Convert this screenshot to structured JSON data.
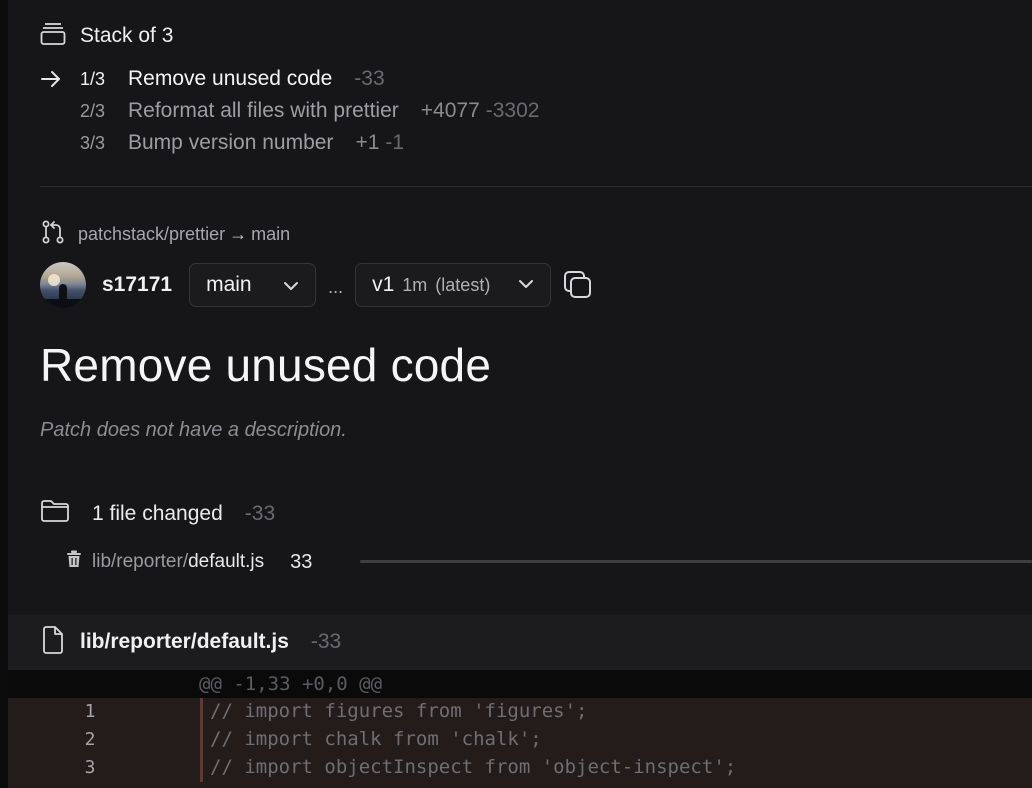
{
  "stack": {
    "title": "Stack of 3",
    "items": [
      {
        "index": "1/3",
        "title": "Remove unused code",
        "additions": "",
        "deletions": "-33",
        "active": true
      },
      {
        "index": "2/3",
        "title": "Reformat all files with prettier",
        "additions": "+4077",
        "deletions": "-3302",
        "active": false
      },
      {
        "index": "3/3",
        "title": "Bump version number",
        "additions": "+1",
        "deletions": "-1",
        "active": false
      }
    ]
  },
  "branch": {
    "source": "patchstack/prettier",
    "arrow": "→",
    "target": "main"
  },
  "meta": {
    "username": "s17171",
    "base_branch": "main",
    "ellipsis": "...",
    "version": "v1",
    "version_time": "1m",
    "version_label": "(latest)"
  },
  "patch": {
    "title": "Remove unused code",
    "description": "Patch does not have a description."
  },
  "files_summary": {
    "label": "1 file changed",
    "deletions": "-33",
    "files": [
      {
        "dir": "lib/reporter/",
        "name": "default.js",
        "count": "33"
      }
    ]
  },
  "diff": {
    "file_name": "lib/reporter/default.js",
    "deletions": "-33",
    "hunk_header": "@@ -1,33 +0,0 @@",
    "lines": [
      {
        "num": "1",
        "code": "// import figures from 'figures';"
      },
      {
        "num": "2",
        "code": "// import chalk from 'chalk';"
      },
      {
        "num": "3",
        "code": "// import objectInspect from 'object-inspect';"
      }
    ]
  },
  "colors": {
    "background": "#161618",
    "deletion_bg": "#231c1b",
    "deletion_bar": "#5a3b38"
  },
  "icons": [
    "stack-icon",
    "arrow-right-icon",
    "git-pull-request-icon",
    "chevron-down-icon",
    "copy-icon",
    "folder-icon",
    "trash-icon",
    "file-icon"
  ]
}
